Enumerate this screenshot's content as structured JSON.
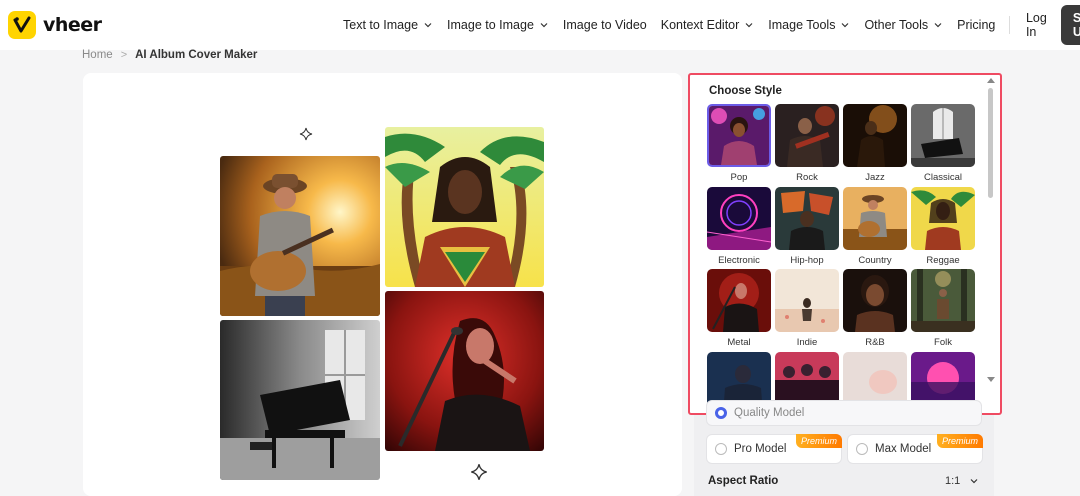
{
  "brand": {
    "name": "vheer",
    "accent": "#ffd400"
  },
  "nav": {
    "items": [
      {
        "label": "Text to Image",
        "dropdown": true
      },
      {
        "label": "Image to Image",
        "dropdown": true
      },
      {
        "label": "Image to Video",
        "dropdown": false
      },
      {
        "label": "Kontext Editor",
        "dropdown": true
      },
      {
        "label": "Image Tools",
        "dropdown": true
      },
      {
        "label": "Other Tools",
        "dropdown": true
      },
      {
        "label": "Pricing",
        "dropdown": false
      }
    ],
    "login_label": "Log In",
    "signup_label": "Sign Up"
  },
  "breadcrumb": {
    "home": "Home",
    "separator": ">",
    "current": "AI Album Cover Maker"
  },
  "preview": {
    "tiles": [
      "guitarist-sunset-field",
      "reggae-palm-trees",
      "grand-piano-bw",
      "metal-singer-red"
    ]
  },
  "style_picker": {
    "title": "Choose Style",
    "selected": "Pop",
    "styles": [
      {
        "label": "Pop"
      },
      {
        "label": "Rock"
      },
      {
        "label": "Jazz"
      },
      {
        "label": "Classical"
      },
      {
        "label": "Electronic"
      },
      {
        "label": "Hip-hop"
      },
      {
        "label": "Country"
      },
      {
        "label": "Reggae"
      },
      {
        "label": "Metal"
      },
      {
        "label": "Indie"
      },
      {
        "label": "R&B"
      },
      {
        "label": "Folk"
      },
      {
        "label": ""
      },
      {
        "label": ""
      },
      {
        "label": ""
      },
      {
        "label": ""
      }
    ]
  },
  "models": {
    "quality": {
      "label": "Quality Model",
      "selected": true
    },
    "pro": {
      "label": "Pro Model",
      "badge": "Premium"
    },
    "max": {
      "label": "Max Model",
      "badge": "Premium"
    }
  },
  "aspect_ratio": {
    "label": "Aspect Ratio",
    "value": "1:1"
  },
  "colors": {
    "highlight_border": "#ef4b62",
    "radio_selected": "#4a63e8",
    "signup_bg": "#3a3a3a"
  }
}
